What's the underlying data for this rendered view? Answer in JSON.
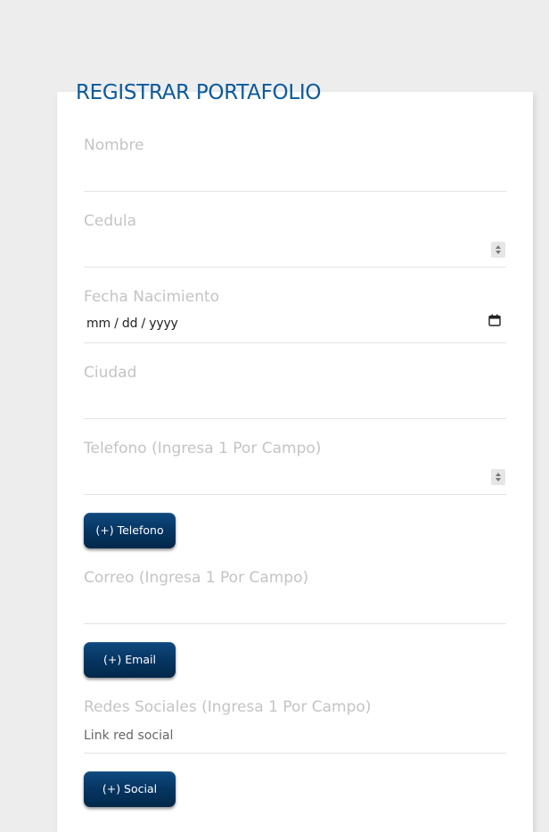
{
  "form": {
    "title": "REGISTRAR PORTAFOLIO"
  },
  "fields": {
    "nombre": {
      "label": "Nombre",
      "value": ""
    },
    "cedula": {
      "label": "Cedula",
      "value": ""
    },
    "fecha_nacimiento": {
      "label": "Fecha Nacimiento",
      "value": "mm / dd / yyyy"
    },
    "ciudad": {
      "label": "Ciudad",
      "value": ""
    },
    "telefono": {
      "label": "Telefono (Ingresa 1 Por Campo)",
      "value": ""
    },
    "correo": {
      "label": "Correo (Ingresa 1 Por Campo)",
      "value": ""
    },
    "redes_sociales": {
      "label": "Redes Sociales (Ingresa 1 Por Campo)",
      "value": "Link red social"
    }
  },
  "buttons": {
    "add_telefono": "(+) Telefono",
    "add_email": "(+) Email",
    "add_social": "(+) Social"
  },
  "icons": {
    "spinner": "number-spinner-icon",
    "calendar": "calendar-icon"
  },
  "colors": {
    "title": "#0a5a9c",
    "label": "#c4c4c4",
    "button": "#063562",
    "background": "#ededed",
    "card": "#ffffff"
  }
}
